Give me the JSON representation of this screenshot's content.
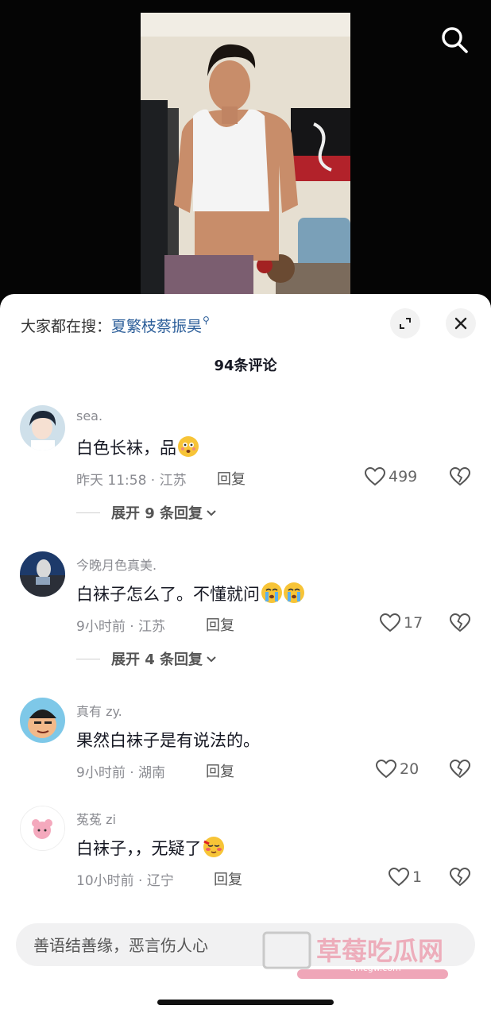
{
  "hot_search": {
    "prefix": "大家都在搜：",
    "keyword": "夏繁枝蔡振昊"
  },
  "comment_count": "94条评论",
  "comments": [
    {
      "user": "sea.",
      "text": "白色长袜，品",
      "time": "昨天 11:58 · 江苏",
      "reply": "回复",
      "likes": "499",
      "expand": "展开 9 条回复",
      "emoji": "flushed-emoji"
    },
    {
      "user": "今晚月色真美.",
      "text": "白袜子怎么了。不懂就问",
      "time": "9小时前 · 江苏",
      "reply": "回复",
      "likes": "17",
      "expand": "展开 4 条回复",
      "emoji": "crying-emoji"
    },
    {
      "user": "真有 zy.",
      "text": "果然白袜子是有说法的。",
      "time": "9小时前 · 湖南",
      "reply": "回复",
      "likes": "20"
    },
    {
      "user": "菟菟 zi",
      "text": "白袜子，，无疑了",
      "time": "10小时前 · 辽宁",
      "reply": "回复",
      "likes": "1",
      "emoji": "blushing-emoji"
    }
  ],
  "input": {
    "placeholder": "善语结善缘，恶言伤人心"
  },
  "watermark": {
    "text": "草莓吃瓜网",
    "url": "cmcgw.com"
  },
  "colors": {
    "accent": "#2d5f9a",
    "meta": "#8a8b91",
    "text": "#161823"
  }
}
